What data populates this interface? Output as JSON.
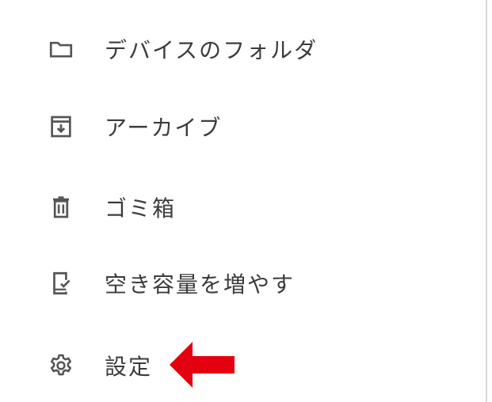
{
  "menu": {
    "items": [
      {
        "icon": "folder-icon",
        "label": "デバイスのフォルダ"
      },
      {
        "icon": "archive-icon",
        "label": "アーカイブ"
      },
      {
        "icon": "trash-icon",
        "label": "ゴミ箱"
      },
      {
        "icon": "phone-check-icon",
        "label": "空き容量を増やす"
      },
      {
        "icon": "gear-icon",
        "label": "設定"
      }
    ]
  },
  "colors": {
    "icon": "#555555",
    "text": "#3c3c3c",
    "annotation_arrow": "#e3000f",
    "divider": "#d8d8d8"
  }
}
